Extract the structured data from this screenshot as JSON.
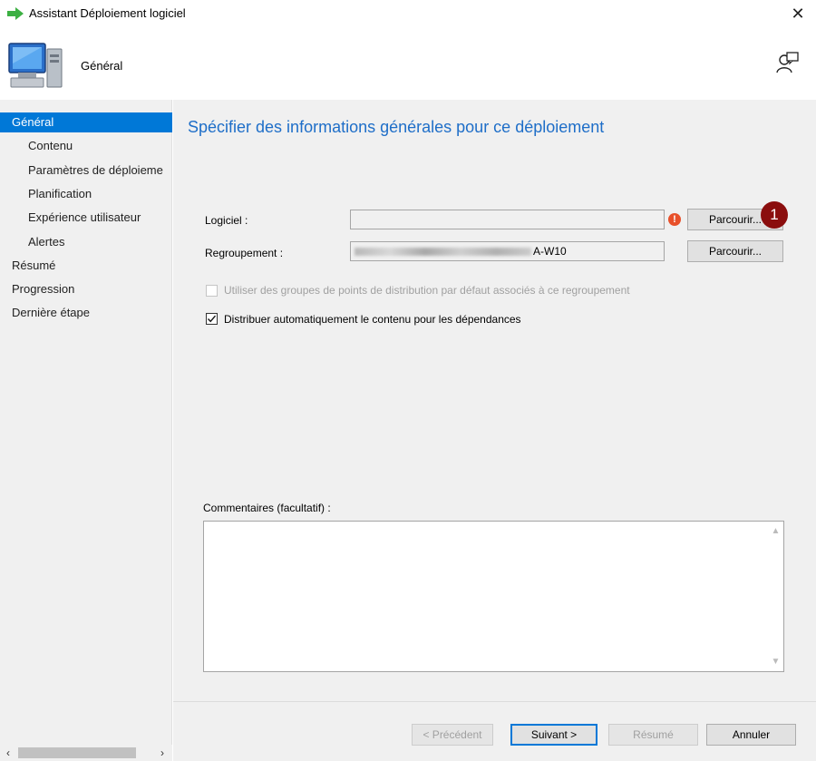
{
  "window": {
    "title": "Assistant Déploiement logiciel",
    "close_glyph": "✕"
  },
  "header": {
    "title": "Général"
  },
  "nav": {
    "items": [
      {
        "label": "Général",
        "level": "top",
        "selected": true
      },
      {
        "label": "Contenu",
        "level": "sub",
        "selected": false
      },
      {
        "label": "Paramètres de déploieme",
        "level": "sub",
        "selected": false
      },
      {
        "label": "Planification",
        "level": "sub",
        "selected": false
      },
      {
        "label": "Expérience utilisateur",
        "level": "sub",
        "selected": false
      },
      {
        "label": "Alertes",
        "level": "sub",
        "selected": false
      },
      {
        "label": "Résumé",
        "level": "top",
        "selected": false
      },
      {
        "label": "Progression",
        "level": "top",
        "selected": false
      },
      {
        "label": "Dernière étape",
        "level": "top",
        "selected": false
      }
    ],
    "scroll_left": "‹",
    "scroll_right": "›"
  },
  "main": {
    "heading": "Spécifier des informations générales pour ce déploiement",
    "software_label": "Logiciel :",
    "software_value": "",
    "warning_glyph": "!",
    "browse_label": "Parcourir...",
    "badge": "1",
    "collection_label": "Regroupement :",
    "collection_value_suffix": "A-W10",
    "checkbox_default_dp": {
      "label": "Utiliser des groupes de points de distribution par défaut associés à ce regroupement",
      "checked": false,
      "enabled": false
    },
    "checkbox_distribute": {
      "label": "Distribuer automatiquement le contenu pour les dépendances",
      "checked": true,
      "enabled": true
    },
    "comments_label": "Commentaires (facultatif) :",
    "comments_value": ""
  },
  "footer": {
    "previous": "< Précédent",
    "next": "Suivant >",
    "summary": "Résumé",
    "cancel": "Annuler"
  },
  "colors": {
    "accent": "#0078d7",
    "heading": "#1e6ec8",
    "badge": "#8b0e0e",
    "warning": "#e8502a"
  }
}
